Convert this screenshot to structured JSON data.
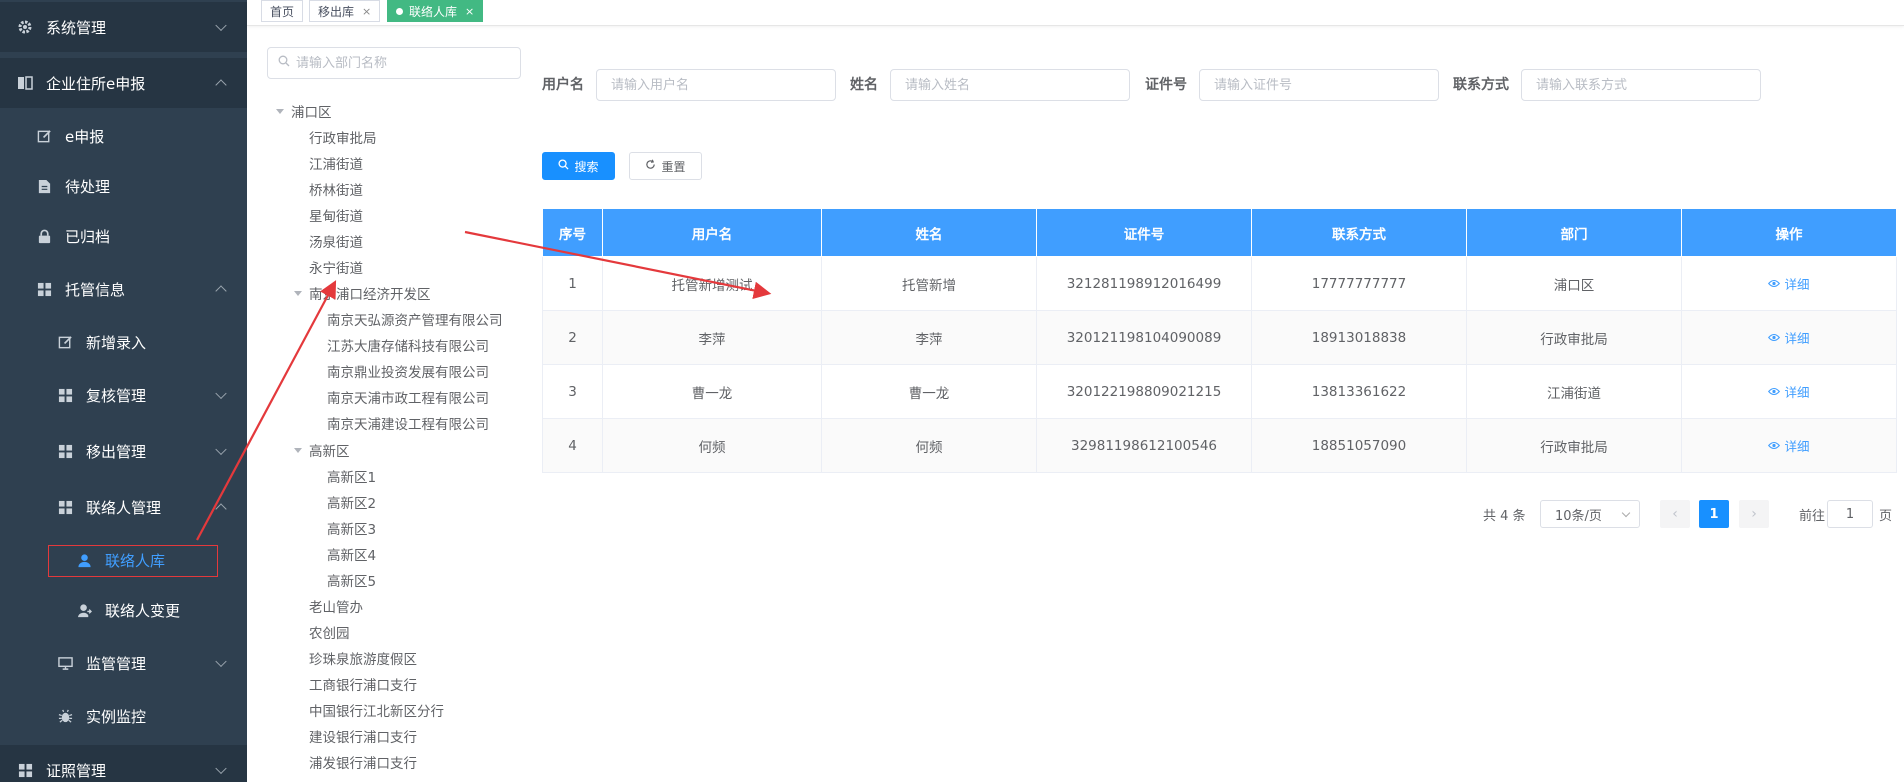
{
  "sidebar": {
    "items": [
      {
        "label": "系统管理",
        "icon": "gear-icon"
      },
      {
        "label": "企业住所e申报",
        "icon": "book-icon"
      },
      {
        "label": "e申报",
        "icon": "edit-icon"
      },
      {
        "label": "待处理",
        "icon": "document-icon"
      },
      {
        "label": "已归档",
        "icon": "lock-icon"
      },
      {
        "label": "托管信息",
        "icon": "grid-icon"
      },
      {
        "label": "新增录入",
        "icon": "edit-icon"
      },
      {
        "label": "复核管理",
        "icon": "grid-icon"
      },
      {
        "label": "移出管理",
        "icon": "grid-icon"
      },
      {
        "label": "联络人管理",
        "icon": "grid-icon"
      },
      {
        "label": "联络人库",
        "icon": "user-icon"
      },
      {
        "label": "联络人变更",
        "icon": "user-change-icon"
      },
      {
        "label": "监管管理",
        "icon": "monitor-icon"
      },
      {
        "label": "实例监控",
        "icon": "bug-icon"
      },
      {
        "label": "证照管理",
        "icon": "grid-icon"
      }
    ]
  },
  "tabs": [
    {
      "label": "首页"
    },
    {
      "label": "移出库"
    },
    {
      "label": "联络人库"
    }
  ],
  "tree": {
    "search_placeholder": "请输入部门名称",
    "nodes": [
      "浦口区",
      "行政审批局",
      "江浦街道",
      "桥林街道",
      "星甸街道",
      "汤泉街道",
      "永宁街道",
      "南京浦口经济开发区",
      "南京天弘源资产管理有限公司",
      "江苏大唐存储科技有限公司",
      "南京鼎业投资发展有限公司",
      "南京天浦市政工程有限公司",
      "南京天浦建设工程有限公司",
      "高新区",
      "高新区1",
      "高新区2",
      "高新区3",
      "高新区4",
      "高新区5",
      "老山管办",
      "农创园",
      "珍珠泉旅游度假区",
      "工商银行浦口支行",
      "中国银行江北新区分行",
      "建设银行浦口支行",
      "浦发银行浦口支行"
    ]
  },
  "form": {
    "username_label": "用户名",
    "username_placeholder": "请输入用户名",
    "name_label": "姓名",
    "name_placeholder": "请输入姓名",
    "id_label": "证件号",
    "id_placeholder": "请输入证件号",
    "contact_label": "联系方式",
    "contact_placeholder": "请输入联系方式",
    "search_label": "搜索",
    "reset_label": "重置"
  },
  "table": {
    "headers": [
      "序号",
      "用户名",
      "姓名",
      "证件号",
      "联系方式",
      "部门",
      "操作"
    ],
    "action_label": "详细",
    "rows": [
      [
        "1",
        "托管新增测试",
        "托管新增",
        "321281198912016499",
        "17777777777",
        "浦口区"
      ],
      [
        "2",
        "李萍",
        "李萍",
        "320121198104090089",
        "18913018838",
        "行政审批局"
      ],
      [
        "3",
        "曹一龙",
        "曹一龙",
        "320122198809021215",
        "13813361622",
        "江浦街道"
      ],
      [
        "4",
        "何频",
        "何频",
        "32981198612100546",
        "18851057090",
        "行政审批局"
      ]
    ]
  },
  "pagination": {
    "total_text": "共 4 条",
    "page_size": "10条/页",
    "current_page": "1",
    "goto_prefix": "前往",
    "goto_value": "1",
    "goto_suffix": "页"
  },
  "colors": {
    "sidebar_bg": "#2f4050",
    "header_bg": "#409eff",
    "primary": "#1890ff",
    "active_tab": "#42b983",
    "annotation": "#e4393c"
  }
}
